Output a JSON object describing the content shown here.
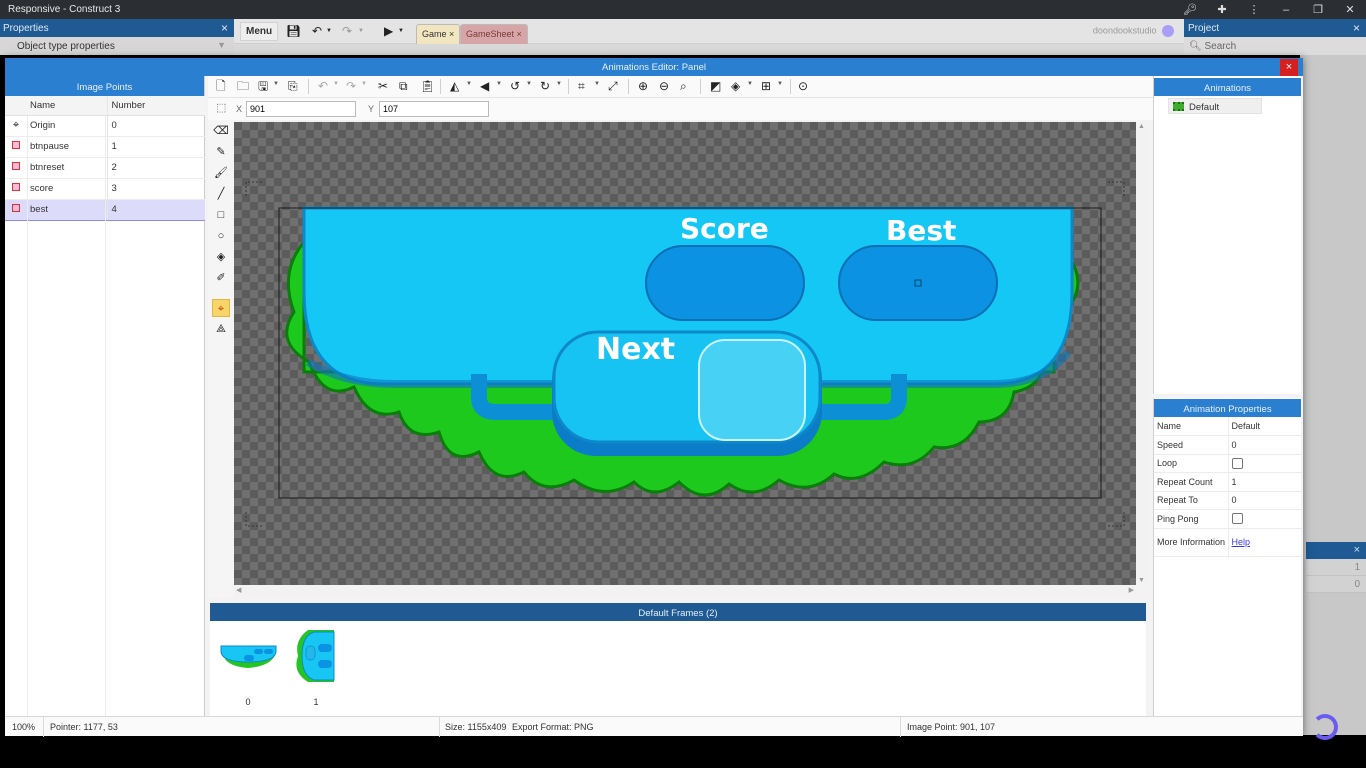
{
  "window": {
    "title": "Responsive - Construct 3",
    "controls": [
      "key-icon",
      "puzzle-icon",
      "more-icon",
      "minimize",
      "restore",
      "close"
    ]
  },
  "properties_panel": {
    "title": "Properties",
    "close": "×",
    "subheader": "Object type properties"
  },
  "main_toolbar": {
    "menu_label": "Menu",
    "tabs": [
      {
        "label": "Game",
        "close": "×"
      },
      {
        "label": "GameSheet",
        "close": "×"
      }
    ],
    "studio_name": "doondookstudio"
  },
  "project_panel": {
    "title": "Project",
    "close": "×",
    "search_placeholder": "Search",
    "mini_rows": [
      "1",
      "0"
    ]
  },
  "dialog": {
    "title": "Animations Editor: Panel",
    "close": "×"
  },
  "image_points": {
    "title": "Image Points",
    "columns": [
      "Name",
      "Number"
    ],
    "rows": [
      {
        "name": "Origin",
        "number": "0",
        "icon": "origin-icon",
        "selected": false
      },
      {
        "name": "btnpause",
        "number": "1",
        "icon": "image-point-icon",
        "selected": false
      },
      {
        "name": "btnreset",
        "number": "2",
        "icon": "image-point-icon",
        "selected": false
      },
      {
        "name": "score",
        "number": "3",
        "icon": "image-point-icon",
        "selected": false
      },
      {
        "name": "best",
        "number": "4",
        "icon": "image-point-icon",
        "selected": true
      }
    ]
  },
  "coords": {
    "x_label": "X",
    "x_value": "901",
    "y_label": "Y",
    "y_value": "107"
  },
  "canvas_art": {
    "score_label": "Score",
    "best_label": "Best",
    "next_label": "Next",
    "colors": {
      "panel": "#16c8f5",
      "panel_dark": "#0f8fd8",
      "slot": "#0a90e0",
      "grass": "#19c619",
      "grass_dark": "#0a8a0a"
    }
  },
  "frames": {
    "title": "Default Frames (2)",
    "items": [
      {
        "index": "0"
      },
      {
        "index": "1"
      }
    ]
  },
  "animations": {
    "title": "Animations",
    "items": [
      {
        "name": "Default"
      }
    ]
  },
  "animation_properties": {
    "title": "Animation Properties",
    "rows": [
      {
        "key": "Name",
        "value": "Default",
        "type": "text"
      },
      {
        "key": "Speed",
        "value": "0",
        "type": "text"
      },
      {
        "key": "Loop",
        "value": false,
        "type": "checkbox"
      },
      {
        "key": "Repeat Count",
        "value": "1",
        "type": "text"
      },
      {
        "key": "Repeat To",
        "value": "0",
        "type": "text"
      },
      {
        "key": "Ping Pong",
        "value": false,
        "type": "checkbox"
      },
      {
        "key": "More Information",
        "value": "Help",
        "type": "link"
      }
    ]
  },
  "status": {
    "zoom": "100%",
    "pointer": "Pointer: 1177, 53",
    "size": "Size: 1155x409",
    "export_format": "Export Format: PNG",
    "image_point": "Image Point: 901, 107"
  },
  "accent_colors": {
    "header_blue": "#2a7fd0",
    "dark_blue": "#1f5a93",
    "selection": "#dcdcfa",
    "active_tool": "#f7d56a"
  }
}
